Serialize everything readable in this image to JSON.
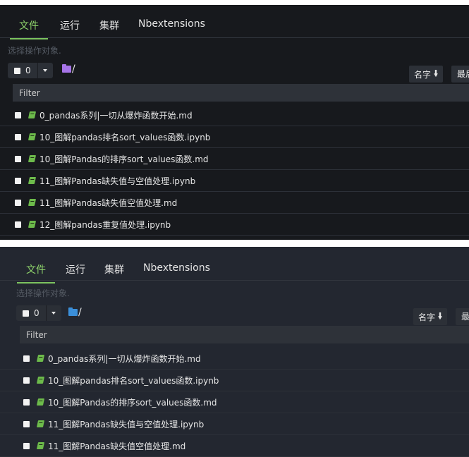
{
  "colors": {
    "accent": "#8ed36b",
    "top_background": "#17191d",
    "bottom_background": "#232730",
    "folder_top": "#a674e8",
    "folder_bottom": "#3b8fd9",
    "notebook_icon": "#6dbb4b"
  },
  "panels": [
    {
      "tabs": [
        "文件",
        "运行",
        "集群",
        "Nbextensions"
      ],
      "active_tab": "文件",
      "hint": "选择操作对象.",
      "select_count": "0",
      "folder_path": "/",
      "sort_label": "名字",
      "last_button_label": "最后",
      "filter_label": "Filter",
      "files": [
        {
          "name": "0_pandas系列|一切从爆炸函数开始.md",
          "icon": "notebook-icon"
        },
        {
          "name": "10_图解pandas排名sort_values函数.ipynb",
          "icon": "notebook-icon"
        },
        {
          "name": "10_图解Pandas的排序sort_values函数.md",
          "icon": "notebook-icon"
        },
        {
          "name": "11_图解Pandas缺失值与空值处理.ipynb",
          "icon": "notebook-icon"
        },
        {
          "name": "11_图解Pandas缺失值空值处理.md",
          "icon": "notebook-icon"
        },
        {
          "name": "12_图解pandas重复值处理.ipynb",
          "icon": "notebook-icon"
        }
      ]
    },
    {
      "tabs": [
        "文件",
        "运行",
        "集群",
        "Nbextensions"
      ],
      "active_tab": "文件",
      "hint": "选择操作对象.",
      "select_count": "0",
      "folder_path": "/",
      "sort_label": "名字",
      "last_button_label": "最后",
      "filter_label": "Filter",
      "files": [
        {
          "name": "0_pandas系列|一切从爆炸函数开始.md",
          "icon": "notebook-icon"
        },
        {
          "name": "10_图解pandas排名sort_values函数.ipynb",
          "icon": "notebook-icon"
        },
        {
          "name": "10_图解Pandas的排序sort_values函数.md",
          "icon": "notebook-icon"
        },
        {
          "name": "11_图解Pandas缺失值与空值处理.ipynb",
          "icon": "notebook-icon"
        },
        {
          "name": "11_图解Pandas缺失值空值处理.md",
          "icon": "notebook-icon"
        }
      ]
    }
  ]
}
